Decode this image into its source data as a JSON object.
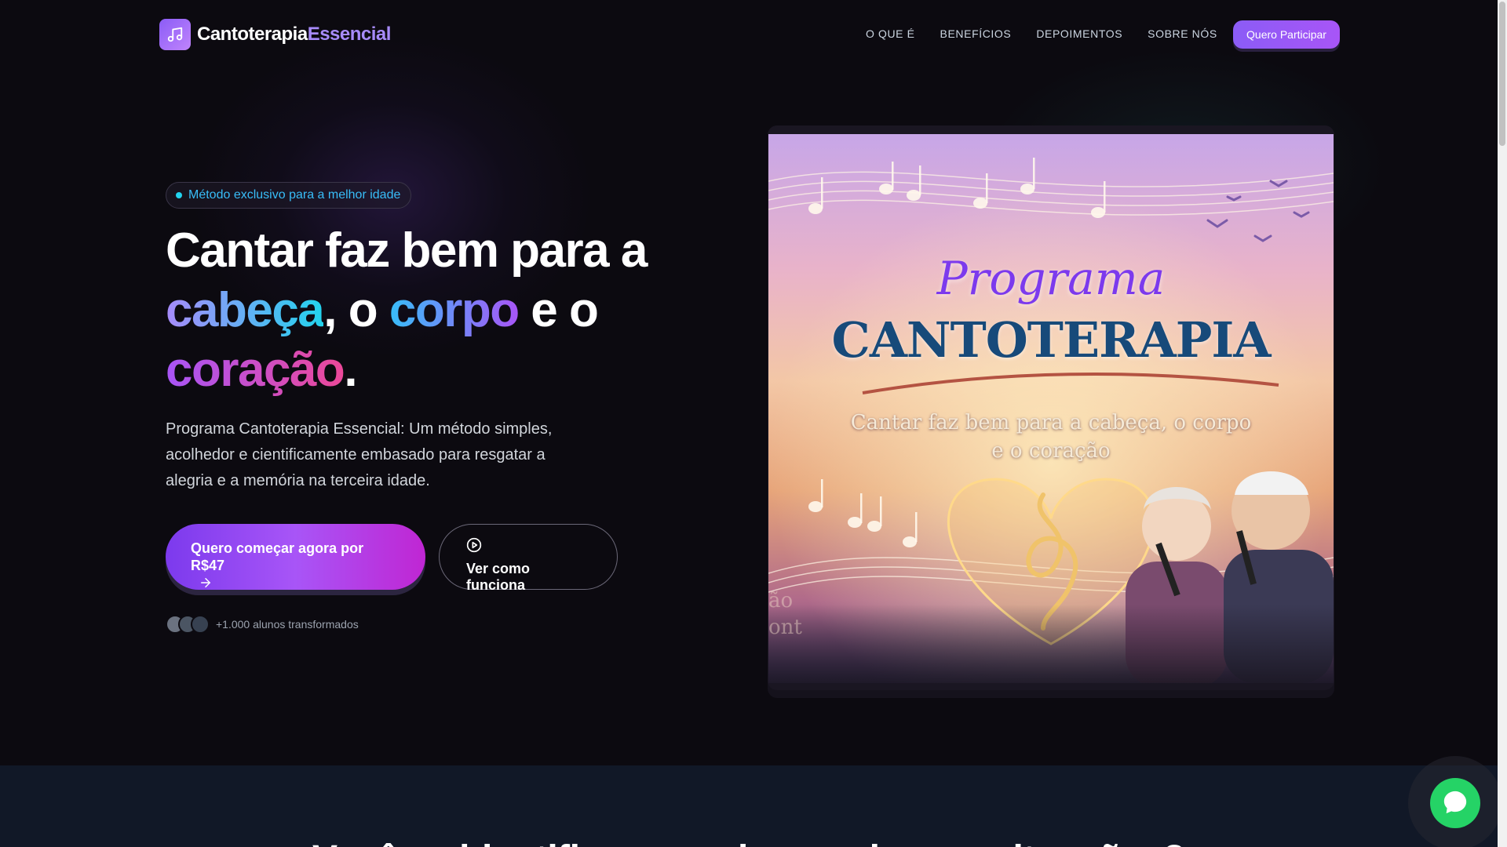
{
  "header": {
    "logo_part1": "Cantoterapia",
    "logo_part2": "Essencial",
    "nav": [
      "O QUE É",
      "BENEFÍCIOS",
      "DEPOIMENTOS",
      "SOBRE NÓS"
    ],
    "cta": "Quero Participar"
  },
  "hero": {
    "badge": "Método exclusivo para a melhor idade",
    "headline": {
      "line1": "Cantar faz bem para a",
      "word_head": "cabeça",
      "sep1": ", o ",
      "word_body": "corpo",
      "sep2": " e o",
      "word_heart": "coração",
      "end": "."
    },
    "description": "Programa Cantoterapia Essencial: Um método simples, acolhedor e cientificamente embasado para resgatar a alegria e a memória na terceira idade.",
    "cta_primary": "Quero começar agora por R$47",
    "cta_secondary": "Ver como funciona",
    "social_proof": "+1.000 alunos transformados"
  },
  "hero_image": {
    "title_line1": "Programa",
    "title_line2": "CANTOTERAPIA",
    "subtitle_line1": "Cantar faz bem para a cabeça, o corpo",
    "subtitle_line2": "e o coração",
    "leftover_line1": "ão",
    "leftover_line2": "ont"
  },
  "section2": {
    "heading": "Você se identifica com alguma dessas situações?"
  },
  "colors": {
    "accent": "#8b5cf6",
    "cyan": "#22d3ee",
    "pink": "#ec4899",
    "chat": "#25d366"
  },
  "icons": [
    "music-note-icon",
    "play-circle-icon",
    "arrow-right-icon",
    "chat-bubble-icon"
  ]
}
